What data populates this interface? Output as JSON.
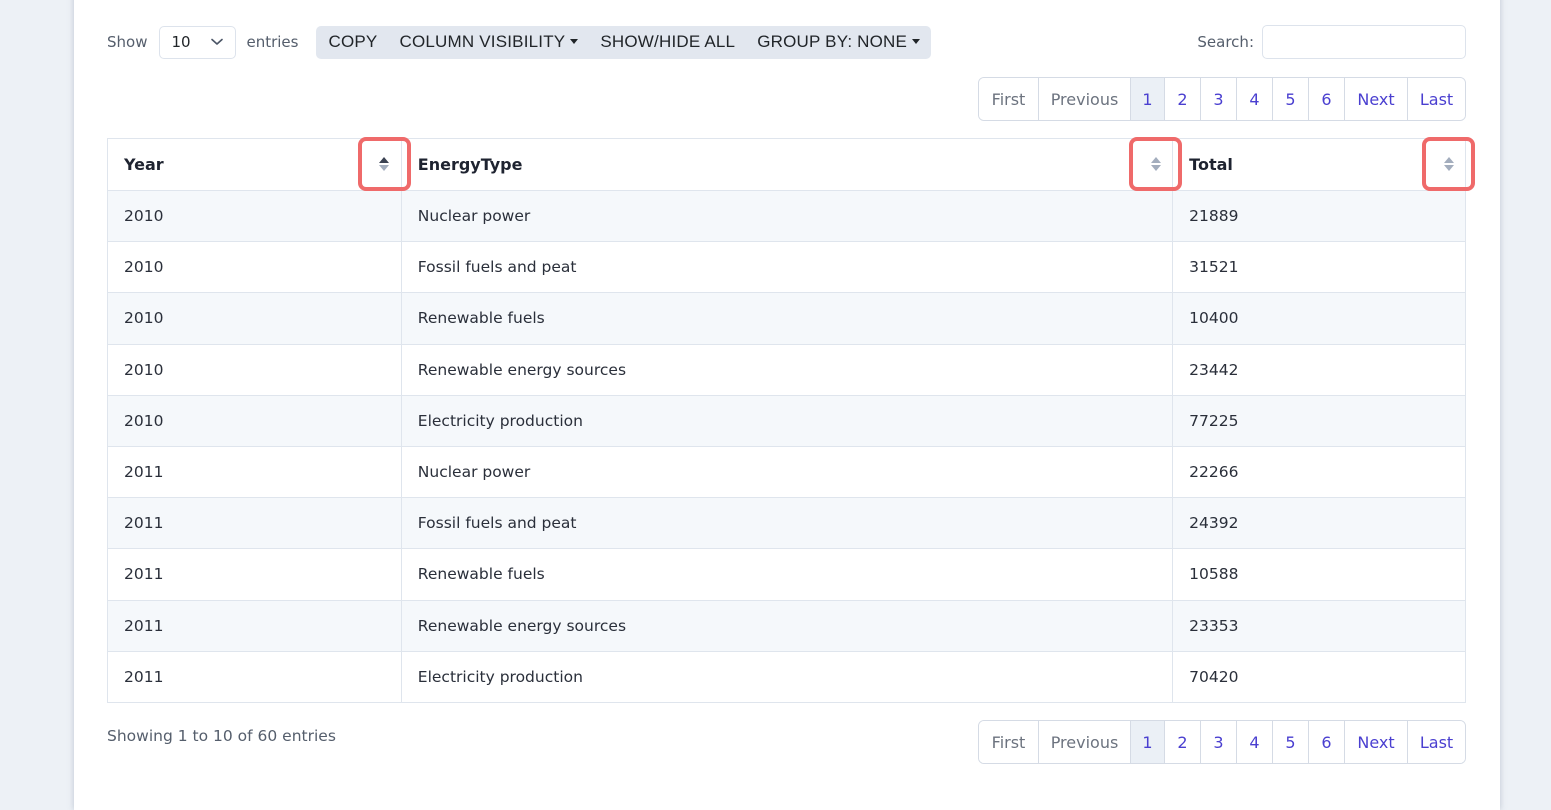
{
  "length_menu": {
    "show_label": "Show",
    "selected": "10",
    "entries_label": "entries"
  },
  "buttons": {
    "copy": "COPY",
    "column_visibility": "COLUMN VISIBILITY",
    "show_hide_all": "SHOW/HIDE ALL",
    "group_by": "GROUP BY: NONE"
  },
  "search": {
    "label": "Search:",
    "value": "",
    "placeholder": ""
  },
  "pagination": {
    "first": "First",
    "previous": "Previous",
    "pages": [
      "1",
      "2",
      "3",
      "4",
      "5",
      "6"
    ],
    "current_page": "1",
    "next": "Next",
    "last": "Last"
  },
  "table": {
    "columns": [
      {
        "label": "Year",
        "sort": "ascending"
      },
      {
        "label": "EnergyType",
        "sort": "none"
      },
      {
        "label": "Total",
        "sort": "none"
      }
    ],
    "rows": [
      [
        "2010",
        "Nuclear power",
        "21889"
      ],
      [
        "2010",
        "Fossil fuels and peat",
        "31521"
      ],
      [
        "2010",
        "Renewable fuels",
        "10400"
      ],
      [
        "2010",
        "Renewable energy sources",
        "23442"
      ],
      [
        "2010",
        "Electricity production",
        "77225"
      ],
      [
        "2011",
        "Nuclear power",
        "22266"
      ],
      [
        "2011",
        "Fossil fuels and peat",
        "24392"
      ],
      [
        "2011",
        "Renewable fuels",
        "10588"
      ],
      [
        "2011",
        "Renewable energy sources",
        "23353"
      ],
      [
        "2011",
        "Electricity production",
        "70420"
      ]
    ]
  },
  "info": "Showing 1 to 10 of 60 entries",
  "colors": {
    "accent_link": "#4a3fd0",
    "highlight_box": "#ef6a6a",
    "sort_active": "#3b4252",
    "sort_inactive": "#a3adbd"
  }
}
